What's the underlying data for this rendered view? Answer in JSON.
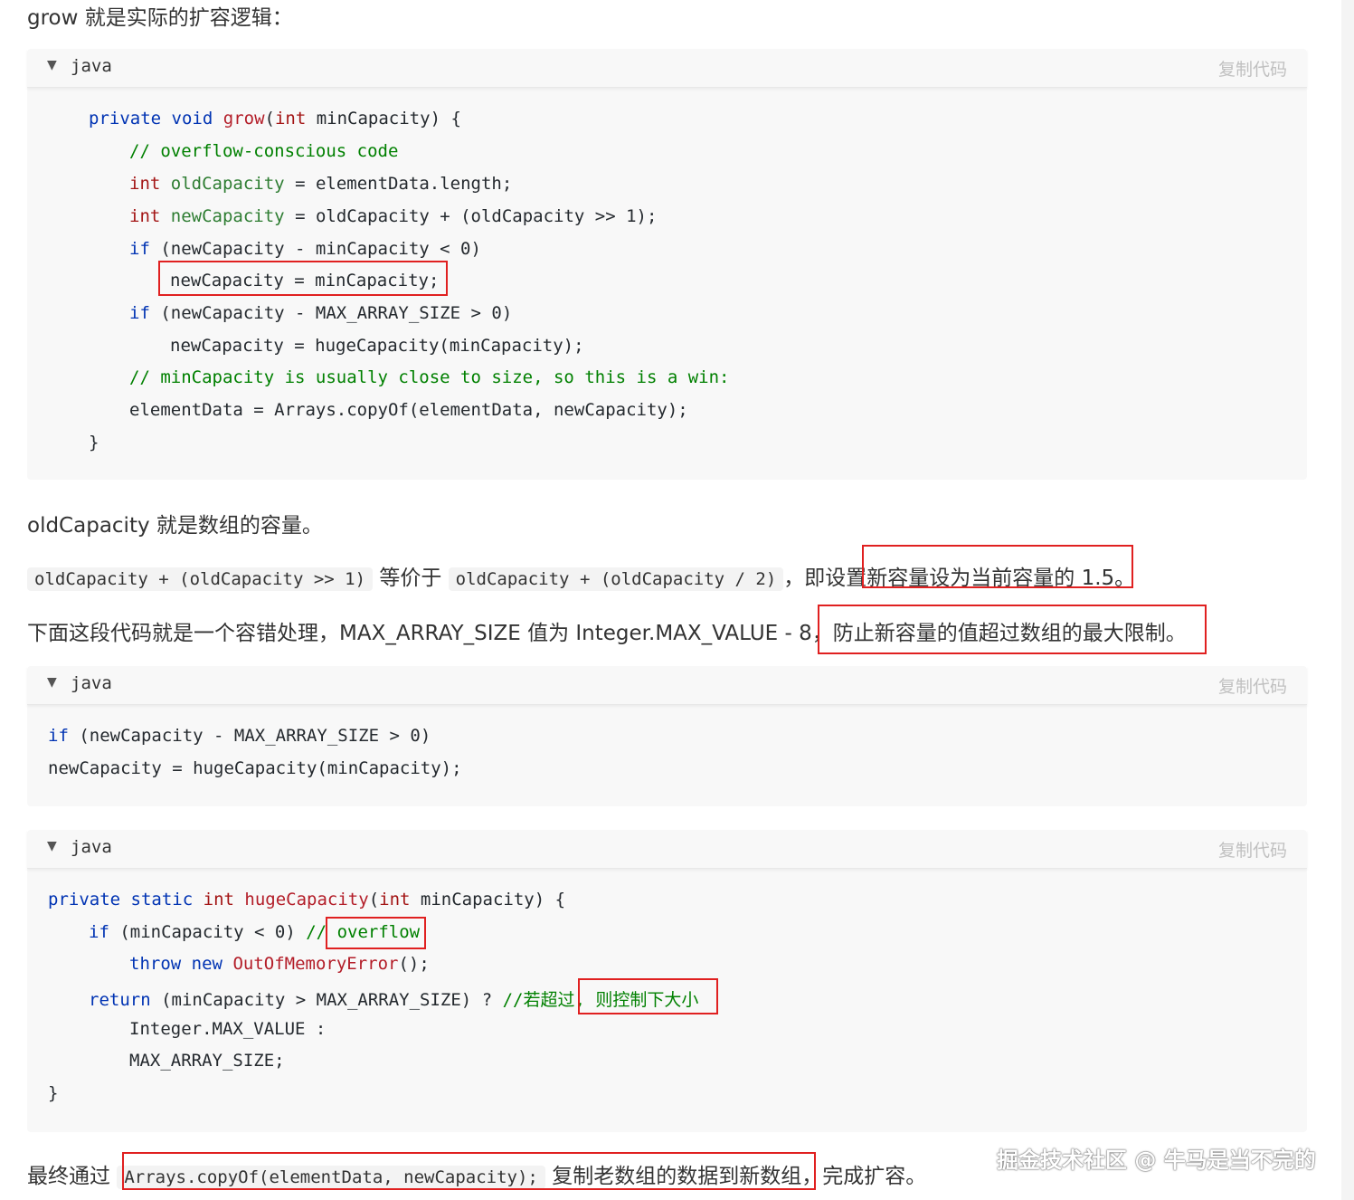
{
  "intro_text": "grow 就是实际的扩容逻辑：",
  "code_blocks": [
    {
      "lang": "java",
      "copy_label": "复制代码",
      "lines": [
        "private void grow(int minCapacity) {",
        "// overflow-conscious code",
        "int oldCapacity = elementData.length;",
        "int newCapacity = oldCapacity + (oldCapacity >> 1);",
        "if (newCapacity - minCapacity < 0)",
        "newCapacity = minCapacity;",
        "if (newCapacity - MAX_ARRAY_SIZE > 0)",
        "newCapacity = hugeCapacity(minCapacity);",
        "// minCapacity is usually close to size, so this is a win:",
        "elementData = Arrays.copyOf(elementData, newCapacity);",
        "}"
      ]
    },
    {
      "lang": "java",
      "copy_label": "复制代码",
      "lines": [
        "if (newCapacity - MAX_ARRAY_SIZE > 0)",
        "newCapacity = hugeCapacity(minCapacity);"
      ]
    },
    {
      "lang": "java",
      "copy_label": "复制代码",
      "lines": [
        "private static int hugeCapacity(int minCapacity) {",
        "if (minCapacity < 0) //",
        "overflow",
        "throw new OutOfMemoryError();",
        "return (minCapacity > MAX_ARRAY_SIZE) ? //若超过,",
        "则控制下大小",
        "Integer.MAX_VALUE :",
        "MAX_ARRAY_SIZE;",
        "}"
      ]
    }
  ],
  "para_old_capacity": "oldCapacity 就是数组的容量。",
  "para_equiv": {
    "code1": "oldCapacity + (oldCapacity >> 1)",
    "text1": "等价于",
    "code2": "oldCapacity + (oldCapacity / 2)",
    "text2": "，即设置",
    "highlight": "新容量设为当前容量的 1.5。"
  },
  "para_fault": {
    "text": "下面这段代码就是一个容错处理，MAX_ARRAY_SIZE 值为 Integer.MAX_VALUE - 8，",
    "highlight": "防止新容量的值超过数组的最大限制。"
  },
  "para_final": {
    "text1": "最终通过",
    "code": "Arrays.copyOf(elementData, newCapacity);",
    "highlight": "复制老数组的数据到新数组",
    "text2": "，完成扩容。"
  },
  "watermark": "掘金技术社区 @ 牛马是当不完的"
}
